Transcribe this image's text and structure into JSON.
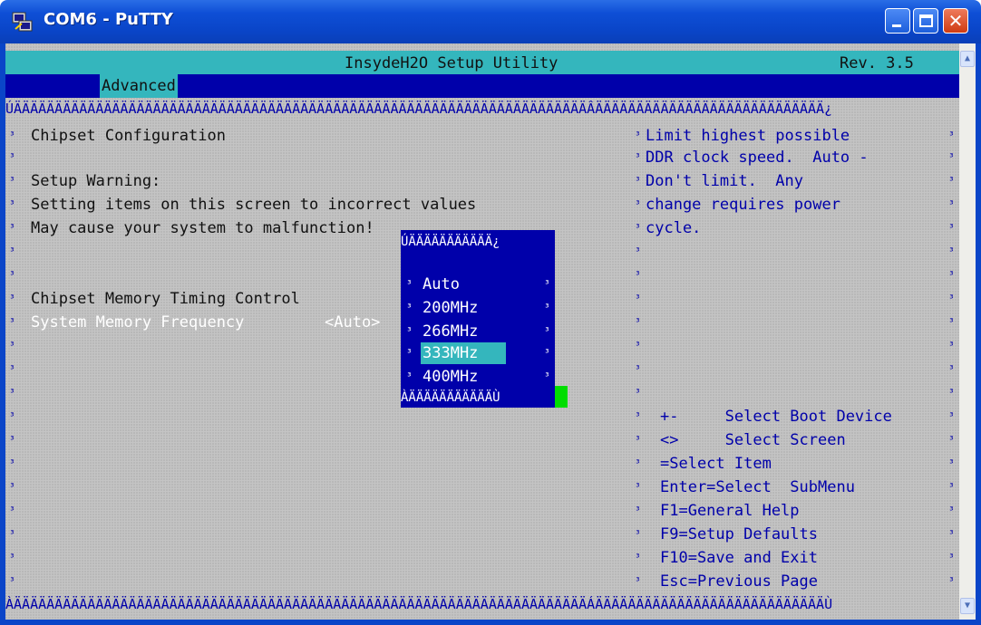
{
  "window": {
    "title": "COM6 - PuTTY",
    "close_glyph": "✕"
  },
  "header": {
    "title": "InsydeH2O Setup Utility",
    "revision": "Rev. 3.5"
  },
  "menu": {
    "active_tab": "Advanced"
  },
  "border": {
    "top": "ÚÄÄÄÄÄÄÄÄÄÄÄÄÄÄÄÄÄÄÄÄÄÄÄÄÄÄÄÄÄÄÄÄÄÄÄÄÄÄÄÄÄÄÄÄÄÄÄÄÄÄÄÄÄÄÄÄÄÄÄÄÄÄÄÄÄÄÄÄÄÄÂÄÄÄÄÄÄÄÄÄÄÄÄÄÄÄÄÄÄÄÄÄÄÄÄÄÄÄÄ¿",
    "bottom": "ÀÄÄÄÄÄÄÄÄÄÄÄÄÄÄÄÄÄÄÄÄÄÄÄÄÄÄÄÄÄÄÄÄÄÄÄÄÄÄÄÄÄÄÄÄÄÄÄÄÄÄÄÄÄÄÄÄÄÄÄÄÄÄÄÄÄÄÄÄÄÄÁÄÄÄÄÄÄÄÄÄÄÄÄÄÄÄÄÄÄÄÄÄÄÄÄÄÄÄÄÙ"
  },
  "left_panel": {
    "heading": "Chipset Configuration",
    "warning_title": "Setup Warning:",
    "warning_line1": "Setting items on this screen to incorrect values",
    "warning_line2": "May cause your system to malfunction!",
    "timing_control": "Chipset Memory Timing Control",
    "memory_frequency_label": "System Memory Frequency",
    "memory_frequency_value": "<Auto>"
  },
  "help_panel": {
    "lines": [
      "Limit highest possible",
      "DDR clock speed.  Auto -",
      "Don't limit.  Any",
      "change requires power",
      "cycle."
    ],
    "keys": [
      "+-     Select Boot Device",
      "<>     Select Screen",
      "=Select Item",
      "Enter=Select  SubMenu",
      "F1=General Help",
      "F9=Setup Defaults",
      "F10=Save and Exit",
      "Esc=Previous Page"
    ]
  },
  "popup": {
    "top_border": "ÚÄÄÄÄÄÄÄÄÄÄÄ¿",
    "bottom_border": "ÀÄÄÄÄÄÄÄÄÄÄÄÙ",
    "options": [
      "Auto",
      "200MHz",
      "266MHz",
      "333MHz",
      "400MHz"
    ],
    "selected": "333MHz"
  },
  "marker_glyph": "³",
  "scrollbar": {
    "up_arrow": "▲",
    "down_arrow": "▼"
  },
  "colors": {
    "titlebar": "#0a45c8",
    "terminal_bg": "#c4c4c4",
    "header_bar": "#34b6bd",
    "menu_bar": "#0000aa",
    "help_text": "#0000aa",
    "popup_bg": "#0000aa",
    "cursor": "#00dd00"
  }
}
